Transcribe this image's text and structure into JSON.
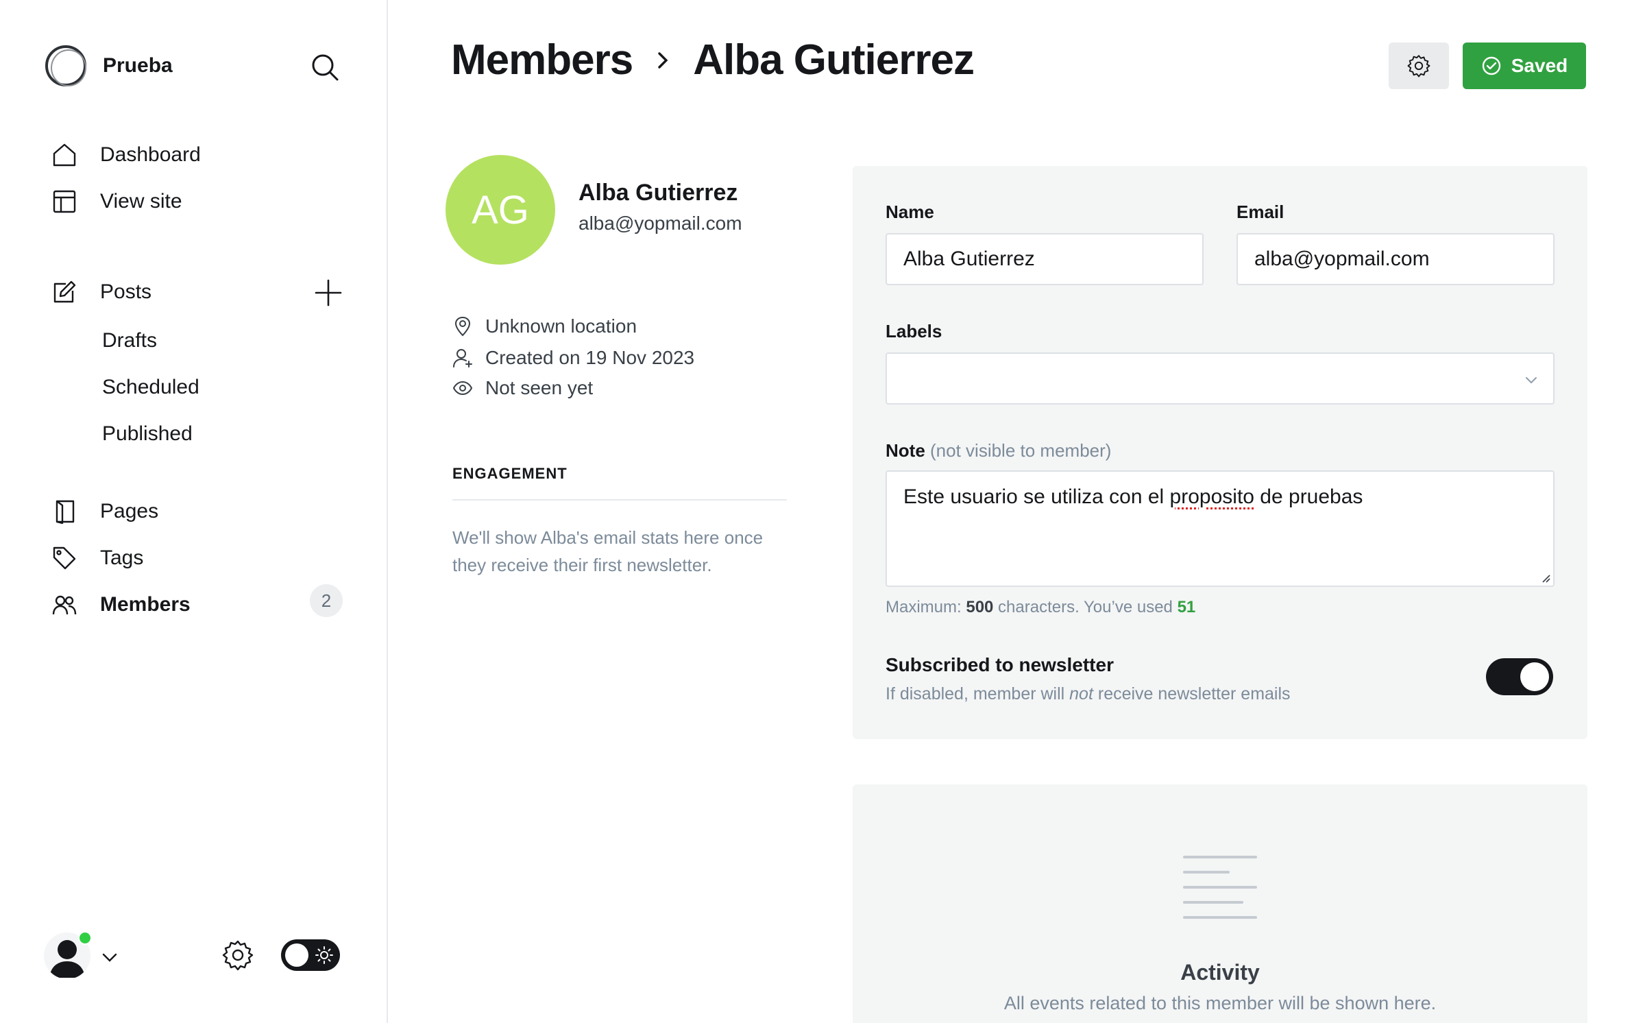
{
  "brand": {
    "name": "Prueba"
  },
  "sidebar": {
    "nav": {
      "dashboard": "Dashboard",
      "view_site": "View site",
      "posts": "Posts",
      "drafts": "Drafts",
      "scheduled": "Scheduled",
      "published": "Published",
      "pages": "Pages",
      "tags": "Tags",
      "members": "Members"
    },
    "members_count": "2"
  },
  "header": {
    "breadcrumb_parent": "Members",
    "breadcrumb_current": "Alba Gutierrez",
    "saved_label": "Saved"
  },
  "member": {
    "initials": "AG",
    "name": "Alba Gutierrez",
    "email": "alba@yopmail.com",
    "location": "Unknown location",
    "created": "Created on 19 Nov 2023",
    "last_seen": "Not seen yet",
    "avatar_color": "#b5e160"
  },
  "engagement": {
    "title": "ENGAGEMENT",
    "text": "We'll show Alba's email stats here once they receive their first newsletter."
  },
  "form": {
    "name_label": "Name",
    "name_value": "Alba Gutierrez",
    "email_label": "Email",
    "email_value": "alba@yopmail.com",
    "labels_label": "Labels",
    "note_label": "Note",
    "note_hint": "(not visible to member)",
    "note_text_before": "Este usuario se utiliza con el ",
    "note_text_misspelled": "proposito",
    "note_text_after": " de pruebas",
    "max_prefix": "Maximum: ",
    "max_value": "500",
    "max_middle": " characters. You’ve used ",
    "used_value": "51",
    "subscribed_title": "Subscribed to newsletter",
    "subscribed_desc_before": "If disabled, member will ",
    "subscribed_desc_emph": "not",
    "subscribed_desc_after": " receive newsletter emails",
    "subscribed": true
  },
  "activity": {
    "title": "Activity",
    "description": "All events related to this member will be shown here."
  },
  "colors": {
    "accent_green": "#30a140",
    "online_dot": "#30cf43",
    "panel_bg": "#f4f5f5"
  },
  "icons": [
    "search-icon",
    "home-icon",
    "layout-icon",
    "edit-icon",
    "plus-icon",
    "page-icon",
    "tag-icon",
    "members-icon",
    "gear-icon",
    "check-circle-icon",
    "location-pin-icon",
    "user-plus-icon",
    "eye-icon",
    "chevron-down-icon",
    "sun-icon",
    "activity-lines-icon"
  ]
}
